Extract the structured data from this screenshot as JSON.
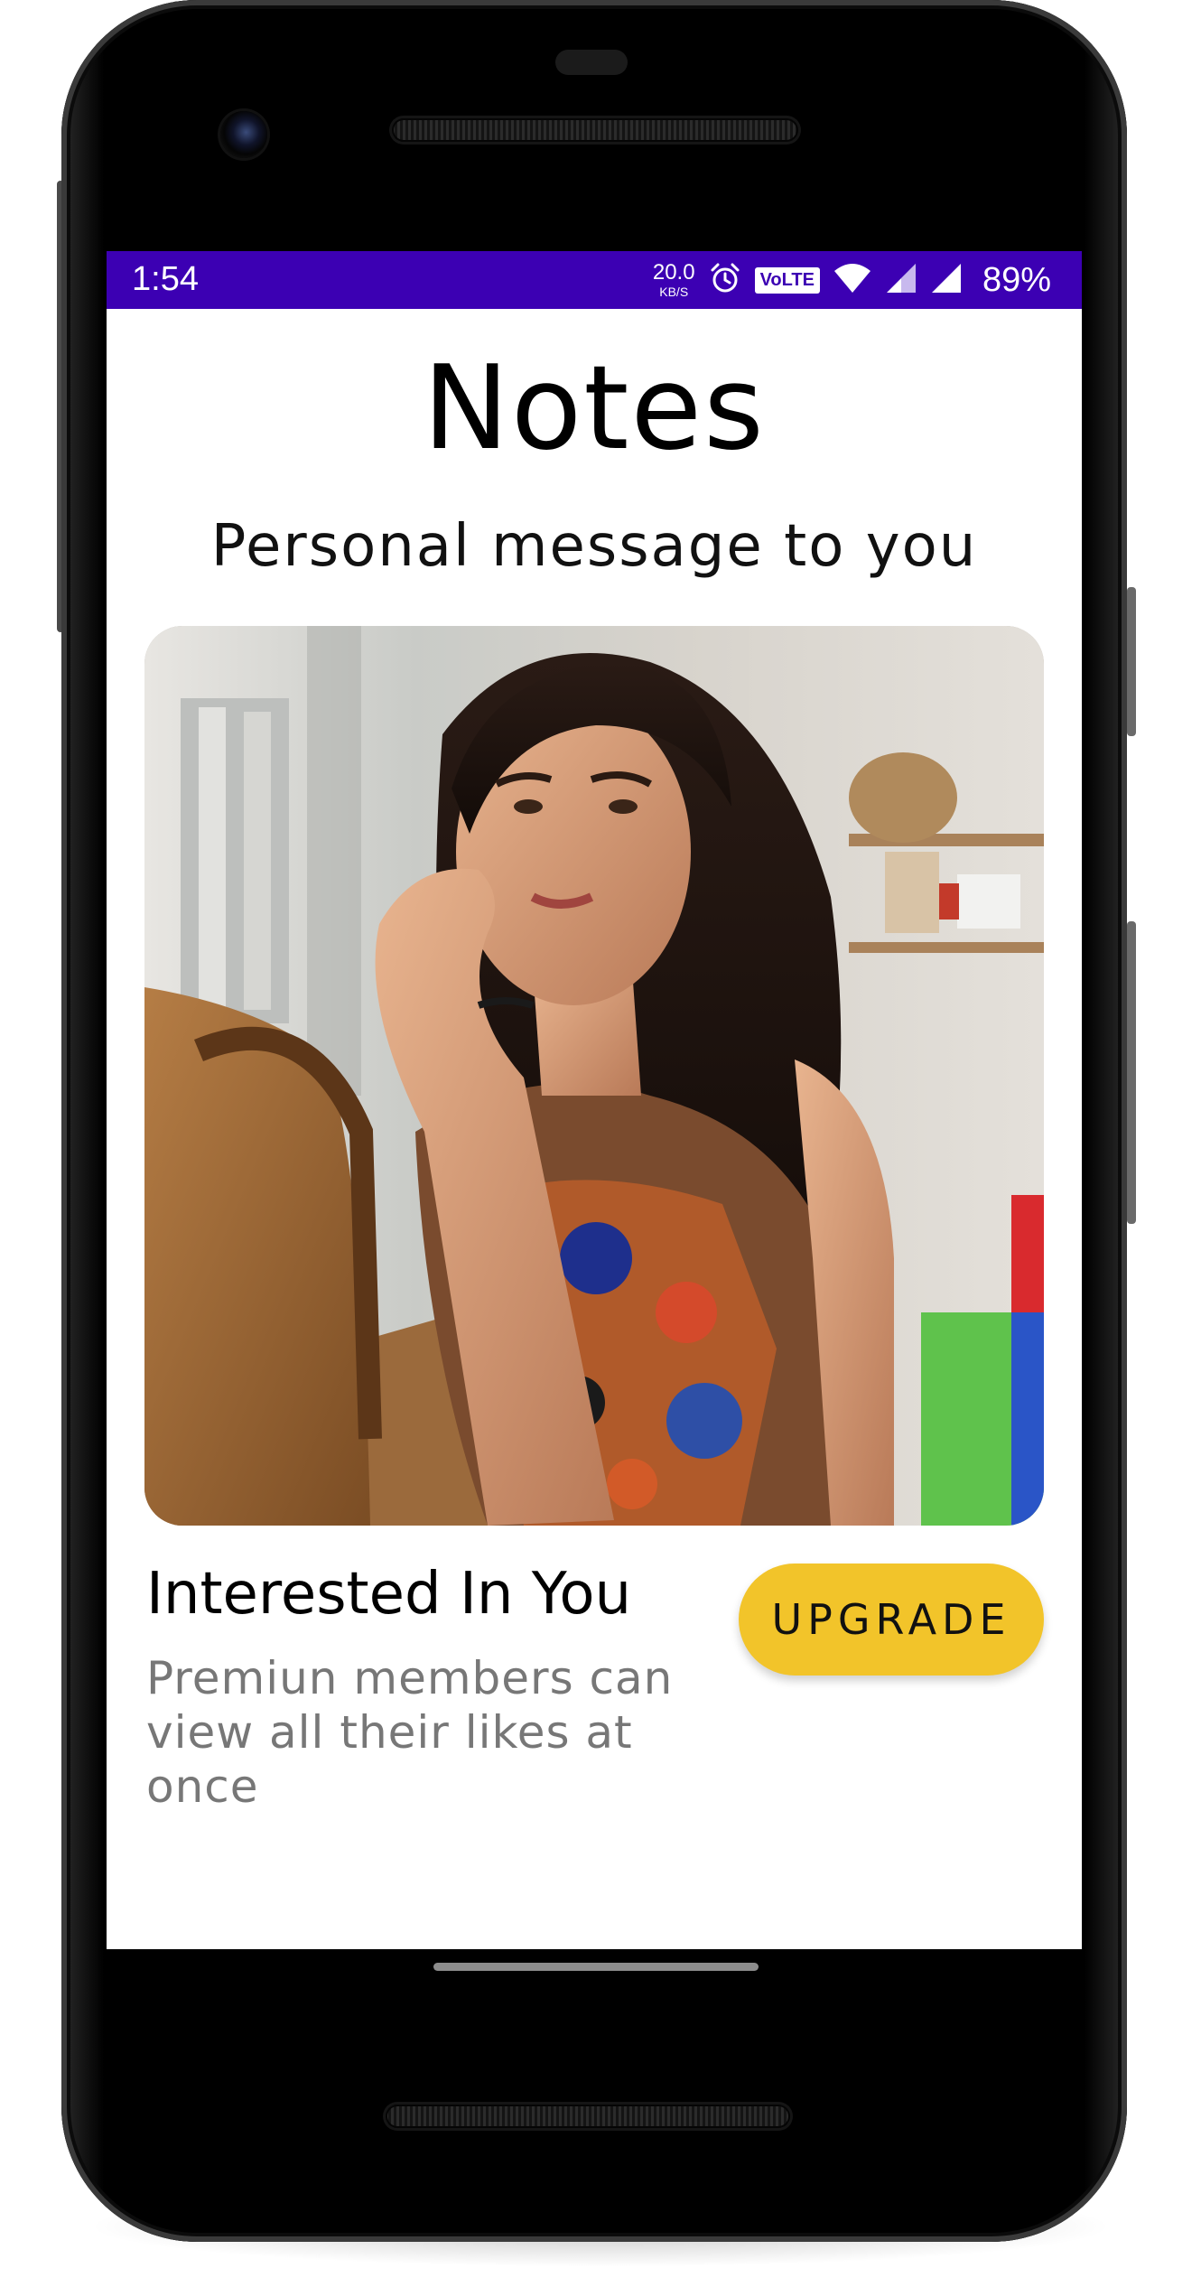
{
  "status_bar": {
    "time": "1:54",
    "net_speed_value": "20.0",
    "net_speed_unit": "KB/S",
    "volte_label": "VoLTE",
    "battery_percent": "89%",
    "icons": [
      "alarm-icon",
      "volte-icon",
      "wifi-icon",
      "signal-icon",
      "signal-icon"
    ],
    "background_color": "#3c00b3"
  },
  "header": {
    "title": "Notes",
    "subtitle": "Personal message to you"
  },
  "card": {
    "photo_alt": "woman-photo",
    "title": "Interested In You",
    "description": "Premiun members can view all their likes at once",
    "upgrade_label": "UPGRADE",
    "upgrade_color": "#f2c42a"
  }
}
